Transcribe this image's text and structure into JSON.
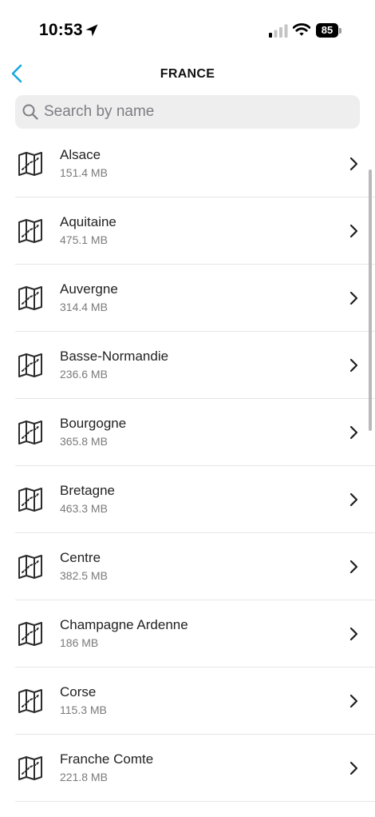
{
  "status_bar": {
    "time": "10:53",
    "battery": "85"
  },
  "nav": {
    "title": "FRANCE",
    "accent_color": "#1aa7e0"
  },
  "search": {
    "placeholder": "Search by name",
    "value": ""
  },
  "regions": [
    {
      "name": "Alsace",
      "size": "151.4 MB"
    },
    {
      "name": "Aquitaine",
      "size": "475.1 MB"
    },
    {
      "name": "Auvergne",
      "size": "314.4 MB"
    },
    {
      "name": "Basse-Normandie",
      "size": "236.6 MB"
    },
    {
      "name": "Bourgogne",
      "size": "365.8 MB"
    },
    {
      "name": "Bretagne",
      "size": "463.3 MB"
    },
    {
      "name": "Centre",
      "size": "382.5 MB"
    },
    {
      "name": "Champagne Ardenne",
      "size": "186 MB"
    },
    {
      "name": "Corse",
      "size": "115.3 MB"
    },
    {
      "name": "Franche Comte",
      "size": "221.8 MB"
    }
  ],
  "icons": {
    "status": [
      "location-arrow-icon",
      "cellular-signal-icon",
      "wifi-icon",
      "battery-icon"
    ],
    "nav_back": "chevron-left-icon",
    "search": "search-icon",
    "row": "map-icon",
    "row_action": "chevron-right-icon"
  }
}
